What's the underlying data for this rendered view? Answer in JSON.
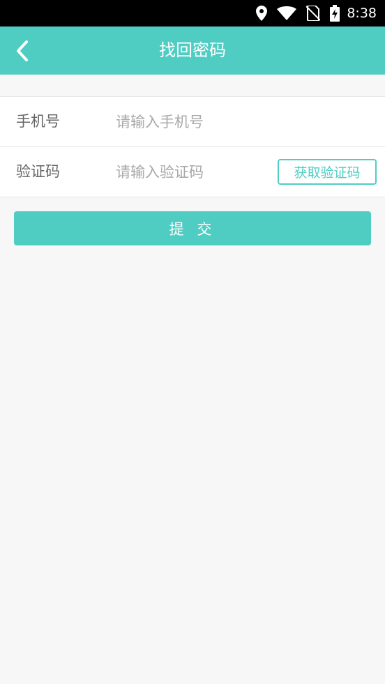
{
  "status_bar": {
    "time": "8:38",
    "icons": [
      "location-icon",
      "wifi-icon",
      "no-sim-icon",
      "battery-charging-icon"
    ]
  },
  "header": {
    "title": "找回密码",
    "back_icon": "chevron-left-icon"
  },
  "form": {
    "phone": {
      "label": "手机号",
      "placeholder": "请输入手机号",
      "value": ""
    },
    "code": {
      "label": "验证码",
      "placeholder": "请输入验证码",
      "value": "",
      "get_code_label": "获取验证码"
    }
  },
  "submit_label": "提 交",
  "colors": {
    "accent": "#4fcdc3",
    "background": "#f7f7f7",
    "status_bar": "#000000"
  }
}
